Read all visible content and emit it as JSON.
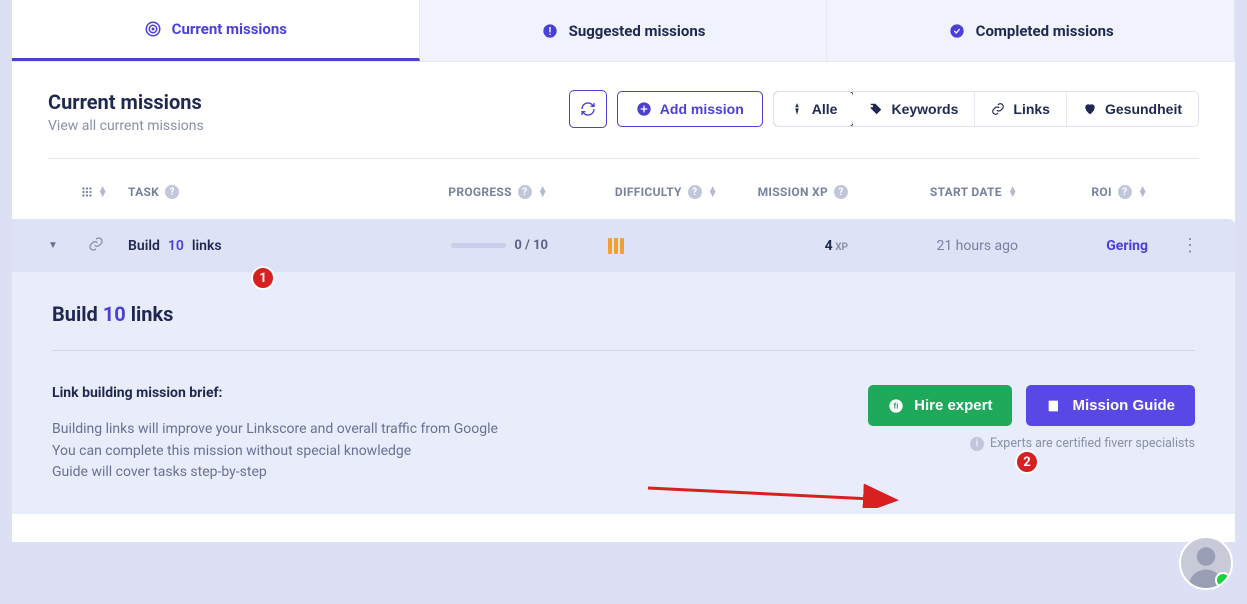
{
  "tabs": {
    "current": "Current missions",
    "suggested": "Suggested missions",
    "completed": "Completed missions"
  },
  "header": {
    "title": "Current missions",
    "subtitle": "View all current missions",
    "add_label": "Add mission"
  },
  "filters": {
    "alle": "Alle",
    "keywords": "Keywords",
    "links": "Links",
    "health": "Gesundheit"
  },
  "columns": {
    "task": "TASK",
    "progress": "PROGRESS",
    "difficulty": "DIFFICULTY",
    "xp": "MISSION XP",
    "date": "START DATE",
    "roi": "ROI"
  },
  "row": {
    "task_prefix": "Build ",
    "task_num": "10",
    "task_suffix": " links",
    "progress": "0 / 10",
    "xp_value": "4",
    "xp_unit": " XP",
    "date": "21 hours ago",
    "roi": "Gering"
  },
  "detail": {
    "title_prefix": "Build ",
    "title_num": "10",
    "title_suffix": " links",
    "brief_heading": "Link building mission brief:",
    "brief_l1": "Building links will improve your Linkscore and overall traffic from Google",
    "brief_l2": "You can complete this mission without special knowledge",
    "brief_l3": "Guide will cover tasks step-by-step",
    "hire": "Hire expert",
    "guide": "Mission Guide",
    "experts_note": "Experts are certified fiverr specialists"
  },
  "annotations": {
    "badge1": "1",
    "badge2": "2"
  }
}
